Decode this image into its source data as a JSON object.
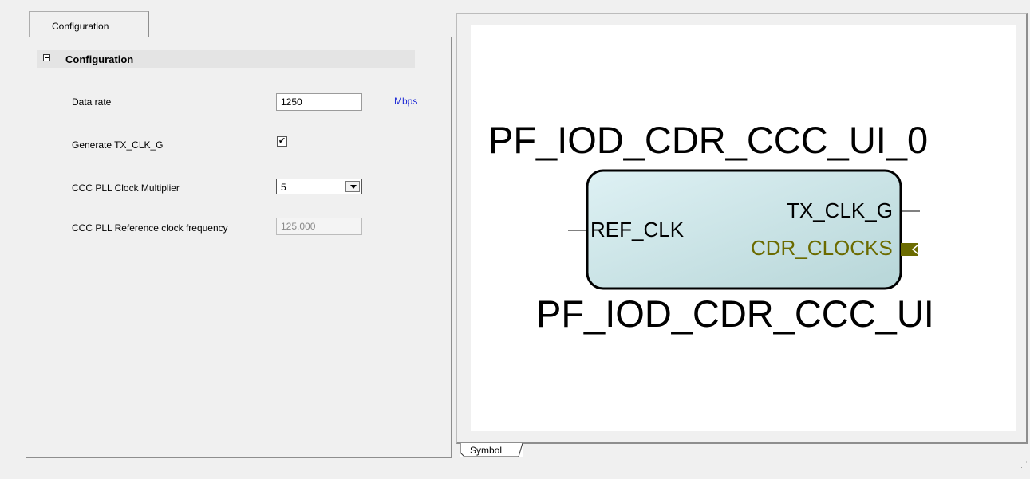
{
  "tabs": {
    "configuration": "Configuration",
    "symbol": "Symbol"
  },
  "section": {
    "title": "Configuration"
  },
  "fields": {
    "data_rate": {
      "label": "Data rate",
      "value": "1250",
      "unit": "Mbps"
    },
    "generate_tx_clk": {
      "label": "Generate TX_CLK_G",
      "checked": true,
      "mark": "✔"
    },
    "pll_multiplier": {
      "label": "CCC PLL Clock Multiplier",
      "value": "5"
    },
    "ref_clk_freq": {
      "label": "CCC PLL Reference clock frequency",
      "value": "125.000"
    }
  },
  "symbol": {
    "instance_name": "PF_IOD_CDR_CCC_UI_0",
    "component_name": "PF_IOD_CDR_CCC_UI",
    "ports": {
      "ref_clk": "REF_CLK",
      "tx_clk_g": "TX_CLK_G",
      "cdr_clocks": "CDR_CLOCKS"
    }
  },
  "colors": {
    "unit_text": "#1f2bd6",
    "bus_port": "#6b6b00",
    "block_fill": "#cde6ea"
  }
}
